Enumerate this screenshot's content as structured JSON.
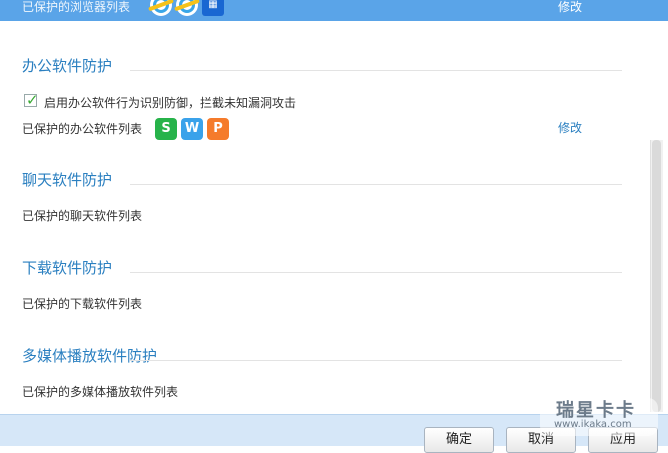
{
  "top_cut": {
    "label": "已保护的浏览器列表",
    "edit": "修改"
  },
  "sections": {
    "office": {
      "title": "办公软件防护",
      "checkbox_label": "启用办公软件行为识别防御，拦截未知漏洞攻击",
      "protected_label": "已保护的办公软件列表",
      "edit": "修改",
      "apps": [
        {
          "letter": "S",
          "color": "#27b34a"
        },
        {
          "letter": "W",
          "color": "#3aa2ea"
        },
        {
          "letter": "P",
          "color": "#f57b2b"
        }
      ]
    },
    "chat": {
      "title": "聊天软件防护",
      "protected_label": "已保护的聊天软件列表"
    },
    "download": {
      "title": "下载软件防护",
      "protected_label": "已保护的下载软件列表"
    },
    "media": {
      "title": "多媒体播放软件防护",
      "protected_label": "已保护的多媒体播放软件列表"
    }
  },
  "footer": {
    "ok": "确定",
    "cancel": "取消",
    "apply": "应用"
  },
  "watermark": {
    "name": "瑞星卡卡",
    "url": "www.ikaka.com"
  }
}
